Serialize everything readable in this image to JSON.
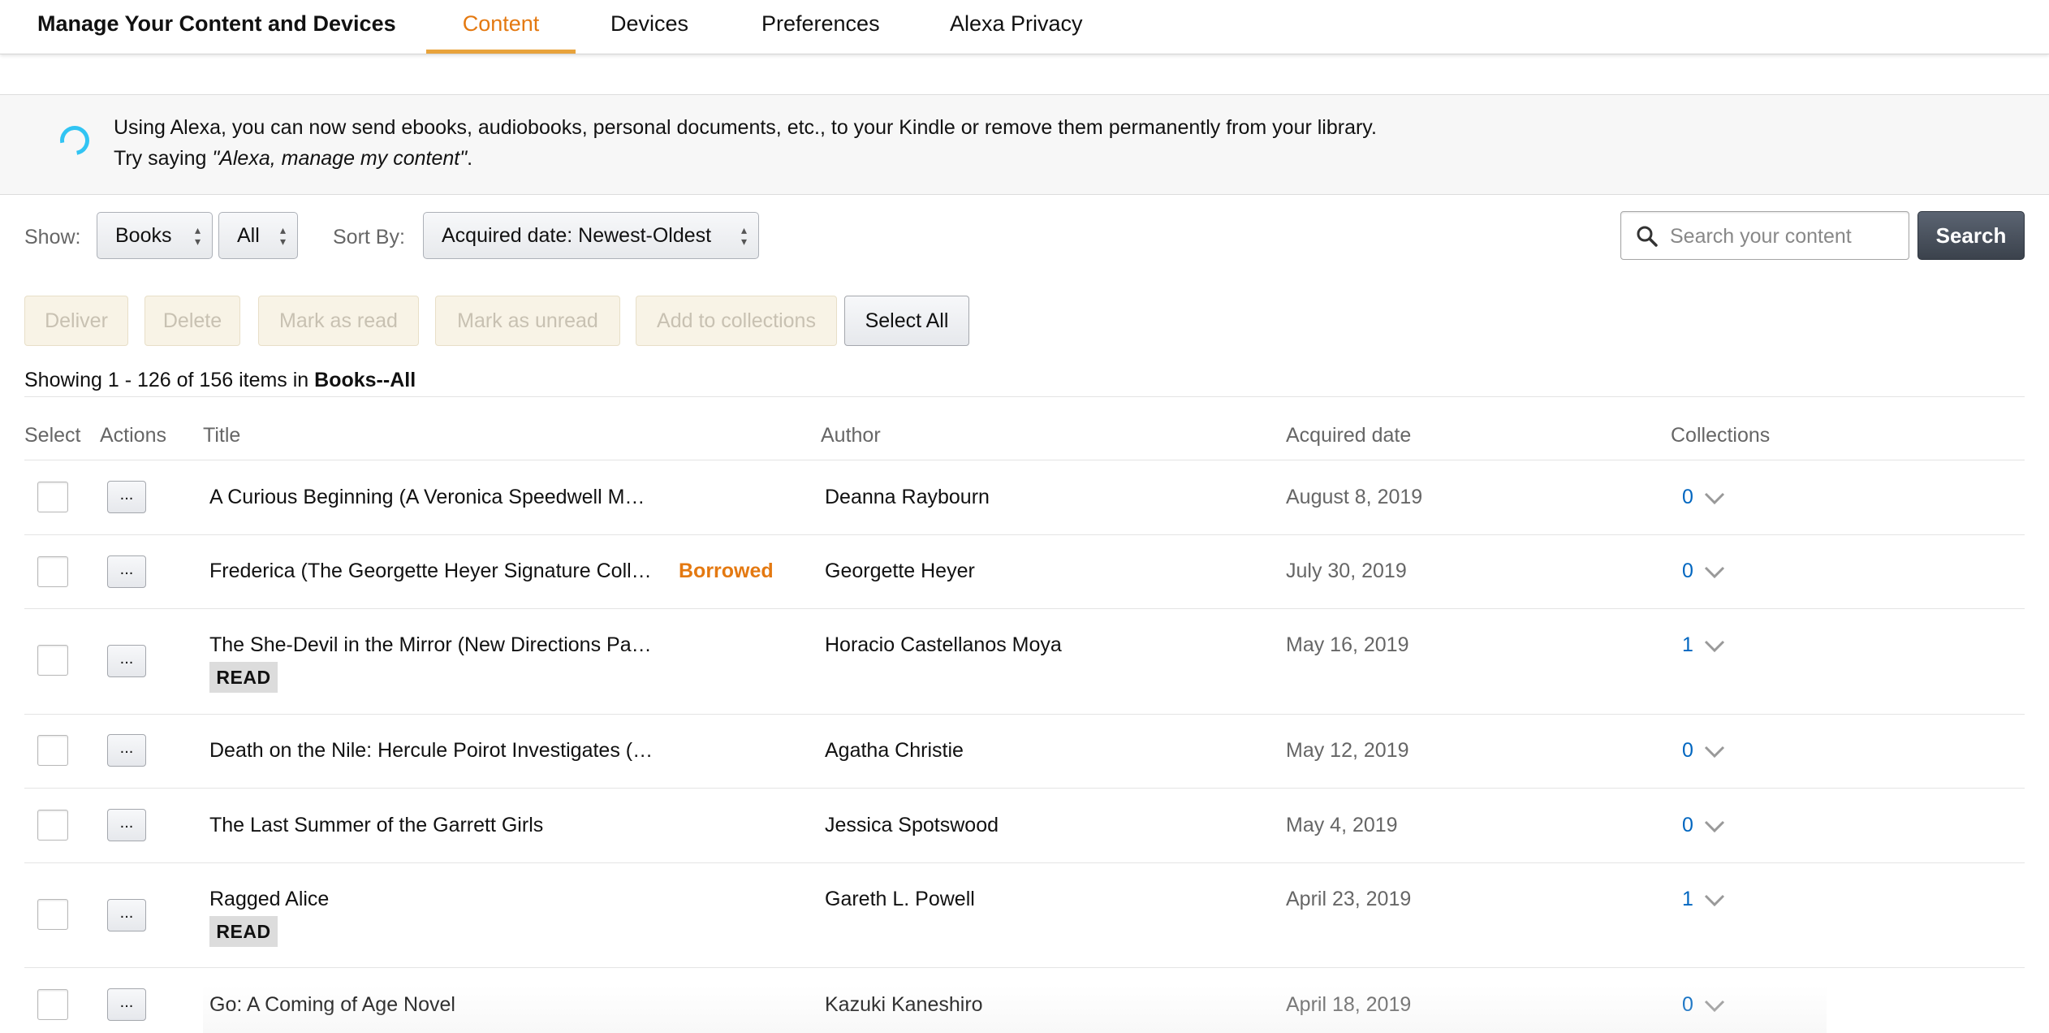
{
  "header": {
    "brand": "Manage Your Content and Devices",
    "tabs": [
      {
        "label": "Content",
        "active": true
      },
      {
        "label": "Devices",
        "active": false
      },
      {
        "label": "Preferences",
        "active": false
      },
      {
        "label": "Alexa Privacy",
        "active": false
      }
    ]
  },
  "banner": {
    "line1": "Using Alexa, you can now send ebooks, audiobooks, personal documents, etc., to your Kindle or remove them permanently from your library.",
    "line2_prefix": "Try saying ",
    "line2_quote": "\"Alexa, manage my content\"",
    "line2_suffix": "."
  },
  "filters": {
    "show_label": "Show:",
    "type_value": "Books",
    "subtype_value": "All",
    "sort_label": "Sort By:",
    "sort_value": "Acquired date: Newest-Oldest",
    "search_placeholder": "Search your content",
    "search_button": "Search"
  },
  "actions": {
    "deliver": "Deliver",
    "delete": "Delete",
    "mark_read": "Mark as read",
    "mark_unread": "Mark as unread",
    "add_collections": "Add to collections",
    "select_all": "Select All"
  },
  "summary": {
    "prefix": "Showing 1 - 126 of 156 items in ",
    "category": "Books--All"
  },
  "table": {
    "headers": {
      "select": "Select",
      "actions": "Actions",
      "title": "Title",
      "author": "Author",
      "date": "Acquired date",
      "collections": "Collections"
    },
    "action_button_label": "...",
    "rows": [
      {
        "title": "A Curious Beginning (A Veronica Speedwell M…",
        "status": "",
        "badge": "",
        "author": "Deanna Raybourn",
        "date": "August 8, 2019",
        "collections": "0"
      },
      {
        "title": "Frederica (The Georgette Heyer Signature Coll…",
        "status": "Borrowed",
        "badge": "",
        "author": "Georgette Heyer",
        "date": "July 30, 2019",
        "collections": "0"
      },
      {
        "title": "The She-Devil in the Mirror (New Directions Pa…",
        "status": "",
        "badge": "READ",
        "author": "Horacio Castellanos Moya",
        "date": "May 16, 2019",
        "collections": "1"
      },
      {
        "title": "Death on the Nile: Hercule Poirot Investigates (…",
        "status": "",
        "badge": "",
        "author": "Agatha Christie",
        "date": "May 12, 2019",
        "collections": "0"
      },
      {
        "title": "The Last Summer of the Garrett Girls",
        "status": "",
        "badge": "",
        "author": "Jessica Spotswood",
        "date": "May 4, 2019",
        "collections": "0"
      },
      {
        "title": "Ragged Alice",
        "status": "",
        "badge": "READ",
        "author": "Gareth L. Powell",
        "date": "April 23, 2019",
        "collections": "1"
      },
      {
        "title": "Go: A Coming of Age Novel",
        "status": "",
        "badge": "",
        "author": "Kazuki Kaneshiro",
        "date": "April 18, 2019",
        "collections": "0"
      }
    ]
  },
  "colors": {
    "active_tab": "#e47911",
    "tab_underline": "#e8a33c",
    "borrowed": "#e47911",
    "link_blue": "#0066c0",
    "alexa_ring": "#31c4f3",
    "search_button": "#3b424c"
  },
  "icons": {
    "alexa": "alexa-ring-icon",
    "search": "search-icon",
    "select_arrows": "up-down-arrows-icon",
    "collections_dropdown": "chevron-down-icon"
  }
}
